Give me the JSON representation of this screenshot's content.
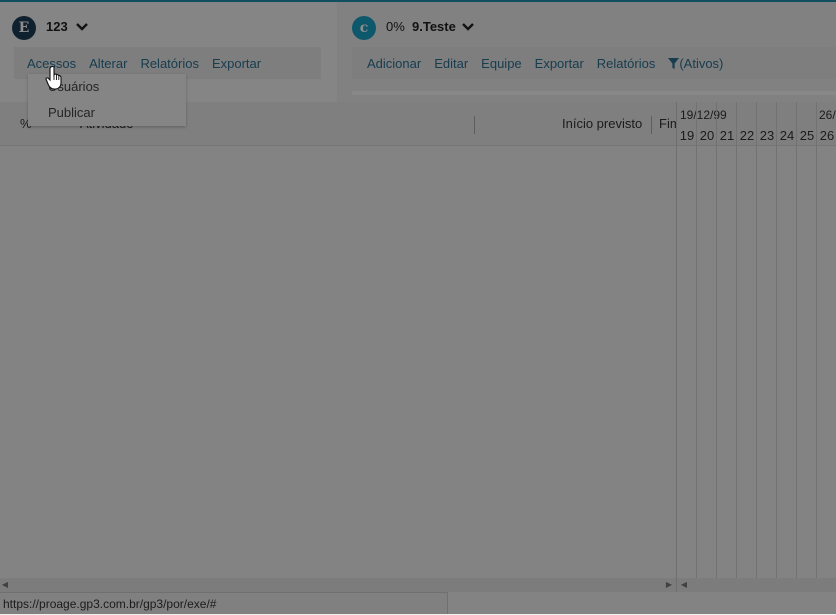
{
  "left_project": {
    "title": "123",
    "logo_letter": "E",
    "menu": [
      "Acessos",
      "Alterar",
      "Relatórios",
      "Exportar"
    ],
    "dropdown": [
      "Usuários",
      "Publicar"
    ]
  },
  "right_project": {
    "progress": "0%",
    "title": "9.Teste",
    "logo_letter": "c",
    "menu": [
      "Adicionar",
      "Editar",
      "Equipe",
      "Exportar",
      "Relatórios"
    ],
    "filter_label": "(Ativos)"
  },
  "grid": {
    "columns": [
      "%",
      "Atividade",
      "Início previsto",
      "Fim"
    ]
  },
  "gantt": {
    "dates": [
      "19/12/99",
      "26/"
    ],
    "days": [
      "19",
      "20",
      "21",
      "22",
      "23",
      "24",
      "25",
      "26"
    ]
  },
  "status": {
    "url": "https://proage.gp3.com.br/gp3/por/exe/#"
  },
  "colors": {
    "accent": "#1f8fb0",
    "menu_link": "#2c6f91",
    "logo_e": "#1d3b57",
    "logo_c": "#1aa0c4"
  },
  "icons": [
    "chevron-down-icon",
    "filter-icon",
    "hand-cursor-icon",
    "scroll-left-icon",
    "scroll-right-icon"
  ]
}
